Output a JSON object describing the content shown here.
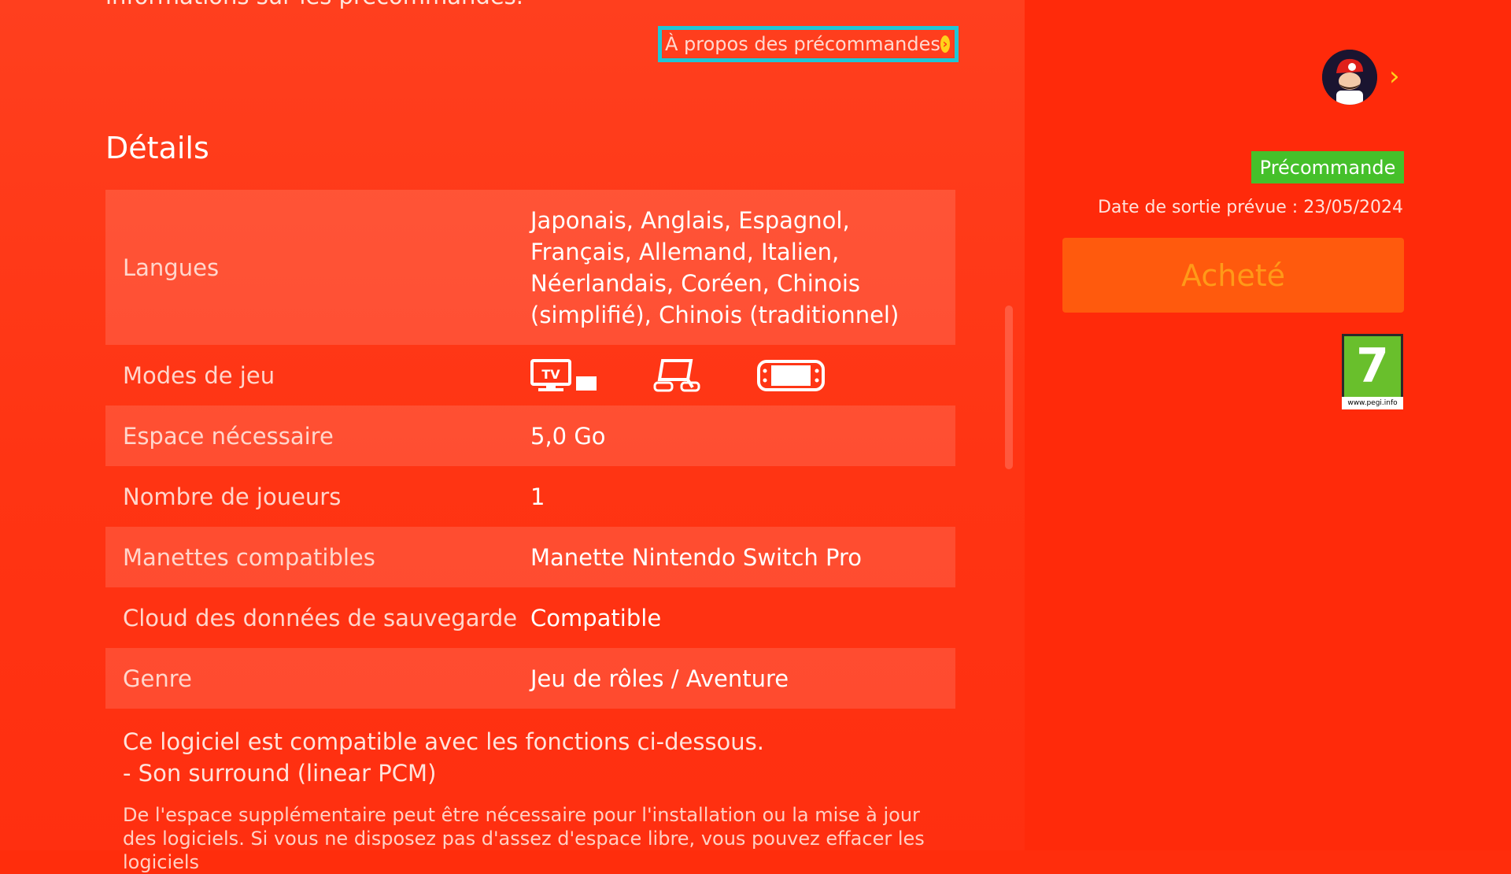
{
  "header": {
    "top_cut_text": "informations sur les précommandes.",
    "preorder_link_label": "À propos des précommandes"
  },
  "details": {
    "title": "Détails",
    "rows": [
      {
        "label": "Langues",
        "value": "Japonais, Anglais, Espagnol, Français, Allemand, Italien, Néerlandais, Coréen, Chinois (simplifié), Chinois (traditionnel)"
      },
      {
        "label": "Modes de jeu",
        "value": "",
        "icons": [
          "tv-mode-icon",
          "tabletop-mode-icon",
          "handheld-mode-icon"
        ]
      },
      {
        "label": "Espace nécessaire",
        "value": "5,0 Go"
      },
      {
        "label": "Nombre de joueurs",
        "value": "1"
      },
      {
        "label": "Manettes compatibles",
        "value": "Manette Nintendo Switch Pro"
      },
      {
        "label": "Cloud des données de sauvegarde",
        "value": "Compatible"
      },
      {
        "label": "Genre",
        "value": "Jeu de rôles / Aventure"
      }
    ]
  },
  "notes": {
    "compat_line": "Ce logiciel est compatible avec les fonctions ci-dessous.",
    "feature_line": "- Son surround (linear PCM)",
    "fine_print": "De l'espace supplémentaire peut être nécessaire pour l'installation ou la mise à jour des logiciels. Si vous ne disposez pas d'assez d'espace libre, vous pouvez effacer les logiciels"
  },
  "sidebar": {
    "badge_label": "Précommande",
    "release_date": "Date de sortie prévue : 23/05/2024",
    "buy_label": "Acheté",
    "rating": {
      "age": "7",
      "site": "www.pegi.info"
    }
  },
  "colors": {
    "background": "#ff2d0c",
    "link_border": "#1fc6d6",
    "badge": "#45c02a",
    "buy_button": "#ff5a0d",
    "pegi_green": "#69bf2c"
  }
}
